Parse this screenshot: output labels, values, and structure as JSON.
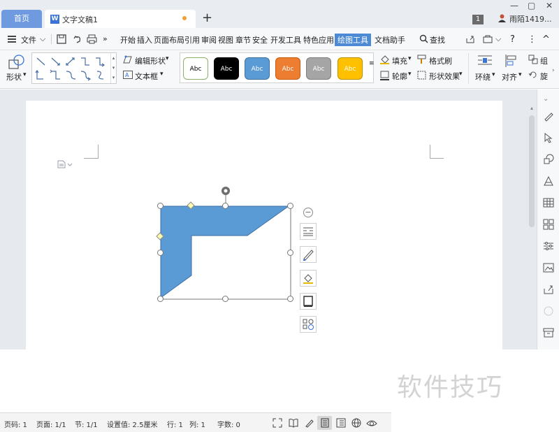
{
  "tabs": {
    "home": "首页",
    "document": "文字文稿1"
  },
  "window": {
    "page_badge": "1",
    "user": "雨陌1419..."
  },
  "menu": {
    "file": "文件",
    "items": [
      "开始",
      "插入",
      "页面布局",
      "引用",
      "审阅",
      "视图",
      "章节",
      "安全",
      "开发工具",
      "特色应用",
      "绘图工具",
      "文档助手"
    ],
    "active": "绘图工具",
    "search": "查找"
  },
  "ribbon": {
    "shape": "形状",
    "edit_shape": "编辑形状",
    "textbox": "文本框",
    "styles": [
      {
        "label": "Abc",
        "bg": "#ffffff",
        "fg": "#000000",
        "border": "#8cb06c"
      },
      {
        "label": "Abc",
        "bg": "#000000",
        "fg": "#ffffff",
        "border": "#000000"
      },
      {
        "label": "Abc",
        "bg": "#5b9bd5",
        "fg": "#ffffff",
        "border": "#41719c"
      },
      {
        "label": "Abc",
        "bg": "#ed7d31",
        "fg": "#ffffff",
        "border": "#c55a11"
      },
      {
        "label": "Abc",
        "bg": "#a5a5a5",
        "fg": "#ffffff",
        "border": "#7f7f7f"
      },
      {
        "label": "Abc",
        "bg": "#ffc000",
        "fg": "#ffffff",
        "border": "#bf9000"
      }
    ],
    "fill": "填充",
    "outline": "轮廓",
    "format_painter": "格式刷",
    "shape_effects": "形状效果",
    "wrap": "环绕",
    "align": "对齐",
    "group": "组",
    "rotate": "旋"
  },
  "shape": {
    "fill": "#5b9bd5"
  },
  "status": {
    "page_code": "页码: 1",
    "pages": "页面: 1/1",
    "section": "节: 1/1",
    "setting": "设置值: 2.5厘米",
    "row": "行: 1",
    "col": "列: 1",
    "words": "字数: 0"
  },
  "watermark": "软件技巧"
}
